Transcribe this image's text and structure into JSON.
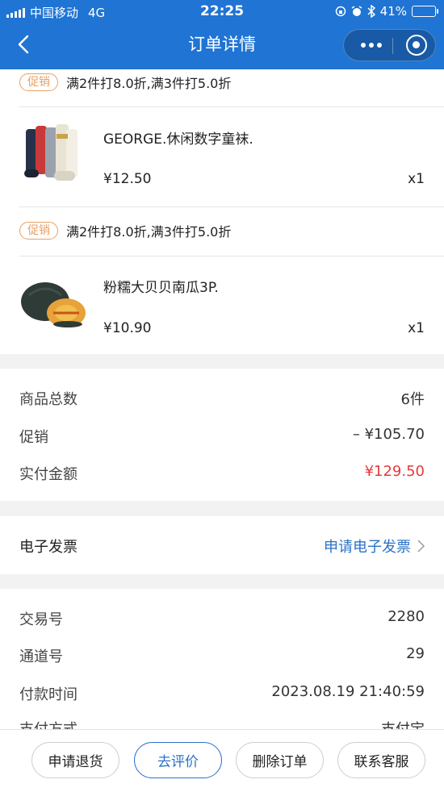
{
  "status_bar": {
    "carrier": "中国移动",
    "network": "4G",
    "time": "22:25",
    "battery": "41%",
    "battery_level": 0.41
  },
  "nav": {
    "title": "订单详情"
  },
  "items": [
    {
      "promo_tag": "促销",
      "promo_text": "满2件打8.0折,满3件打5.0折",
      "name": "GEORGE.休闲数字童袜.",
      "price": "¥12.50",
      "qty": "x1"
    },
    {
      "promo_tag": "促销",
      "promo_text": "满2件打8.0折,满3件打5.0折",
      "name": "粉糯大贝贝南瓜3P.",
      "price": "¥10.90",
      "qty": "x1"
    }
  ],
  "summary": {
    "total_count_label": "商品总数",
    "total_count_value": "6件",
    "promo_label": "促销",
    "promo_value": "– ¥105.70",
    "paid_label": "实付金额",
    "paid_value": "¥129.50"
  },
  "invoice": {
    "label": "电子发票",
    "link": "申请电子发票"
  },
  "details": {
    "trade_no_label": "交易号",
    "trade_no_value": "2280",
    "channel_label": "通道号",
    "channel_value": "29",
    "pay_time_label": "付款时间",
    "pay_time_value": "2023.08.19 21:40:59",
    "pay_method_label": "支付方式",
    "pay_method_value": "支付宝"
  },
  "footer": {
    "refund": "申请退货",
    "review": "去评价",
    "delete": "删除订单",
    "service": "联系客服"
  },
  "colors": {
    "brand": "#1f74d4",
    "accent_red": "#e63a3a",
    "promo": "#e8a062",
    "link": "#2a72c8"
  }
}
